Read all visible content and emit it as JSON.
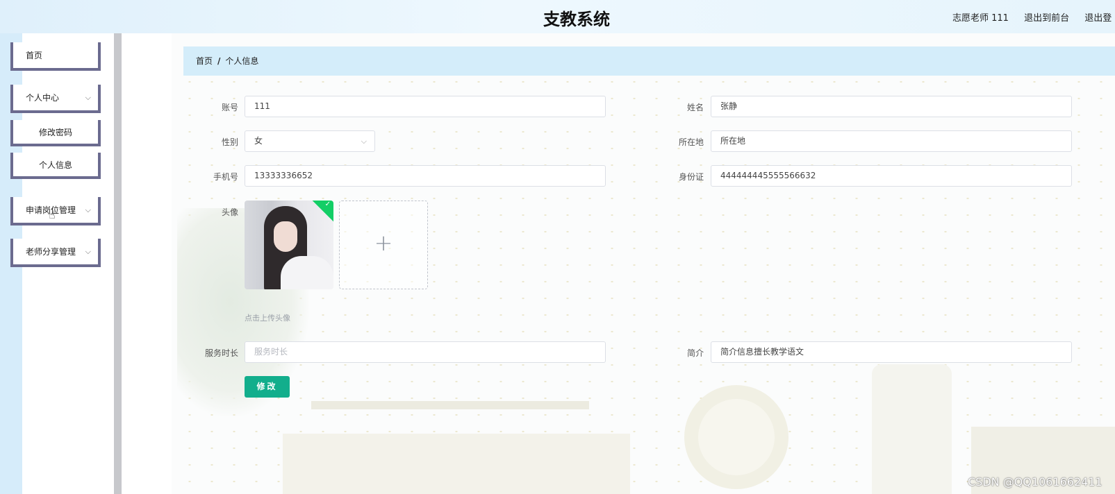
{
  "header": {
    "app_title": "支教系统",
    "user_label": "志愿老师 111",
    "back_front_label": "退出到前台",
    "logout_label": "退出登"
  },
  "sidebar": {
    "items": [
      {
        "label": "首页"
      },
      {
        "label": "个人中心"
      },
      {
        "label": "修改密码"
      },
      {
        "label": "个人信息"
      },
      {
        "label": "申请岗位管理"
      },
      {
        "label": "老师分享管理"
      }
    ]
  },
  "breadcrumb": {
    "home": "首页",
    "separator": "/",
    "current": "个人信息"
  },
  "form": {
    "account": {
      "label": "账号",
      "value": "111"
    },
    "name": {
      "label": "姓名",
      "value": "张静"
    },
    "gender": {
      "label": "性别",
      "value": "女"
    },
    "location": {
      "label": "所在地",
      "value": "所在地"
    },
    "phone": {
      "label": "手机号",
      "value": "13333336652"
    },
    "id_card": {
      "label": "身份证",
      "value": "444444445555566632"
    },
    "avatar": {
      "label": "头像",
      "upload_tip": "点击上传头像"
    },
    "service_hours": {
      "label": "服务时长",
      "placeholder": "服务时长"
    },
    "intro": {
      "label": "简介",
      "value": "简介信息擅长教学语文"
    },
    "submit_label": "修改"
  },
  "watermark": "CSDN @QQ1061662411",
  "colors": {
    "primary_button": "#12ae8c",
    "breadcrumb_bg": "#d4edfa",
    "sidebar_border": "#6b6b8f",
    "upload_success": "#13ce66"
  }
}
